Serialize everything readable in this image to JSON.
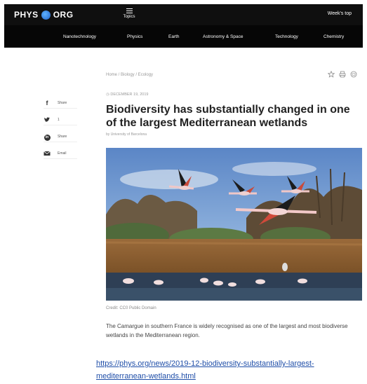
{
  "header": {
    "logo_left": "PHYS",
    "logo_right": "ORG",
    "topics_label": "Topics",
    "weeks_label": "Week's top"
  },
  "nav": {
    "items": [
      "Nanotechnology",
      "Physics",
      "Earth",
      "Astronomy & Space",
      "Technology",
      "Chemistry"
    ]
  },
  "breadcrumb": "Home / Biology / Ecology",
  "share": {
    "items": [
      {
        "icon": "facebook-icon",
        "label": "Share"
      },
      {
        "icon": "twitter-icon",
        "label": "1"
      },
      {
        "icon": "linkedin-icon",
        "label": "Share"
      },
      {
        "icon": "email-icon",
        "label": "Email"
      }
    ]
  },
  "article": {
    "date": "DECEMBER 19, 2019",
    "title": "Biodiversity has substantially changed in one of the largest Mediterranean wetlands",
    "byline": "by University of Barcelona",
    "image_credit": "Credit: CC0 Public Domain",
    "summary": "The Camargue in southern France is widely recognised as one of the largest and most biodiverse wetlands in the Mediterranean region."
  },
  "url": "https://phys.org/news/2019-12-biodiversity-substantially-largest-mediterranean-wetlands.html",
  "colors": {
    "nav_bg": "#0f0f0f",
    "link": "#1f4ea8"
  }
}
